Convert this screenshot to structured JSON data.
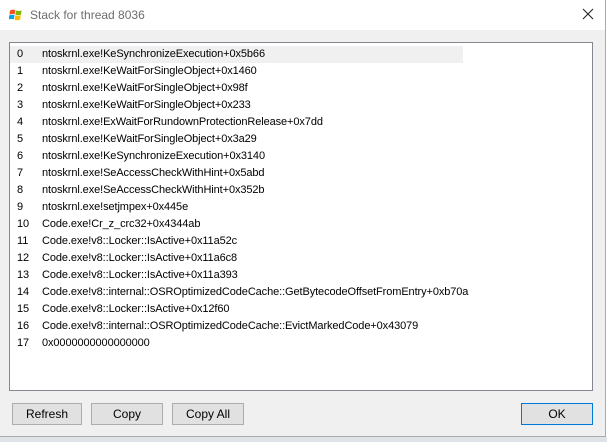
{
  "window": {
    "title": "Stack for thread 8036"
  },
  "stack": {
    "frames": [
      {
        "index": "0",
        "frame": "ntoskrnl.exe!KeSynchronizeExecution+0x5b66"
      },
      {
        "index": "1",
        "frame": "ntoskrnl.exe!KeWaitForSingleObject+0x1460"
      },
      {
        "index": "2",
        "frame": "ntoskrnl.exe!KeWaitForSingleObject+0x98f"
      },
      {
        "index": "3",
        "frame": "ntoskrnl.exe!KeWaitForSingleObject+0x233"
      },
      {
        "index": "4",
        "frame": "ntoskrnl.exe!ExWaitForRundownProtectionRelease+0x7dd"
      },
      {
        "index": "5",
        "frame": "ntoskrnl.exe!KeWaitForSingleObject+0x3a29"
      },
      {
        "index": "6",
        "frame": "ntoskrnl.exe!KeSynchronizeExecution+0x3140"
      },
      {
        "index": "7",
        "frame": "ntoskrnl.exe!SeAccessCheckWithHint+0x5abd"
      },
      {
        "index": "8",
        "frame": "ntoskrnl.exe!SeAccessCheckWithHint+0x352b"
      },
      {
        "index": "9",
        "frame": "ntoskrnl.exe!setjmpex+0x445e"
      },
      {
        "index": "10",
        "frame": "Code.exe!Cr_z_crc32+0x4344ab"
      },
      {
        "index": "11",
        "frame": "Code.exe!v8::Locker::IsActive+0x11a52c"
      },
      {
        "index": "12",
        "frame": "Code.exe!v8::Locker::IsActive+0x11a6c8"
      },
      {
        "index": "13",
        "frame": "Code.exe!v8::Locker::IsActive+0x11a393"
      },
      {
        "index": "14",
        "frame": "Code.exe!v8::internal::OSROptimizedCodeCache::GetBytecodeOffsetFromEntry+0xb70a"
      },
      {
        "index": "15",
        "frame": "Code.exe!v8::Locker::IsActive+0x12f60"
      },
      {
        "index": "16",
        "frame": "Code.exe!v8::internal::OSROptimizedCodeCache::EvictMarkedCode+0x43079"
      },
      {
        "index": "17",
        "frame": "0x0000000000000000"
      }
    ]
  },
  "buttons": {
    "refresh": "Refresh",
    "copy": "Copy",
    "copy_all": "Copy All",
    "ok": "OK"
  },
  "icons": {
    "app": "windows-flag-icon",
    "close": "close-icon"
  }
}
